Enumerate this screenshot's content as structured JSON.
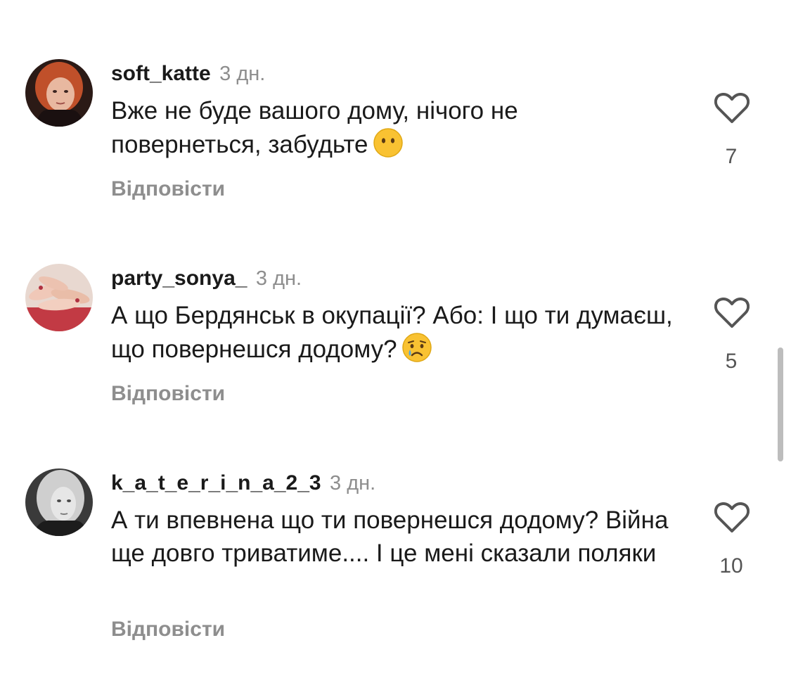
{
  "comments": [
    {
      "username": "soft_katte",
      "time": "3 дн.",
      "text": "Вже не буде вашого дому, нічого не повернеться, забудьте",
      "emoji": "face-without-mouth",
      "reply_label": "Відповісти",
      "likes": "7",
      "avatar": "user-photo-red-hair"
    },
    {
      "username": "party_sonya_",
      "time": "3 дн.",
      "text": "А що Бердянськ в окупації? Або: І що ти думаєш, що повернешся додому?",
      "emoji": "crying-face",
      "reply_label": "Відповісти",
      "likes": "5",
      "avatar": "photo-of-hands"
    },
    {
      "username": "k_a_t_e_r_i_n_a_2_3",
      "time": "3 дн.",
      "text": "А ти впевнена що ти повернешся додому? Війна ще довго триватиме.... І це мені сказали поляки",
      "emoji": "",
      "reply_label": "Відповісти",
      "likes": "10",
      "avatar": "user-photo-blonde-bw"
    }
  ],
  "colors": {
    "text": "#1a1a1a",
    "secondary": "#8e8e8e",
    "like_count": "#555555",
    "scrollbar": "#bdbdbd"
  }
}
